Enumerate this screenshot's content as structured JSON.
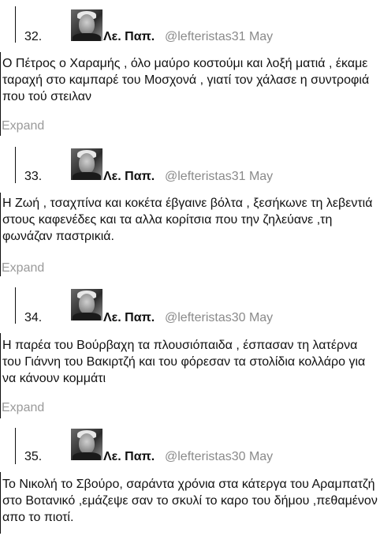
{
  "tweets": [
    {
      "number": "32.",
      "name": "Λε. Παπ.",
      "handle": "@lefteristas31 May",
      "text": "Ο Πέτρος ο Χαραμής , όλο μαύρο κοστούμι και λοξή ματιά , έκαμε ταραχή στο καμπαρέ του Μοσχονά , γιατί τον χάλασε η συντροφιά που τού στειλαν",
      "expand": "Expand"
    },
    {
      "number": "33.",
      "name": "Λε. Παπ.",
      "handle": "@lefteristas31 May",
      "text": "Η Ζωή , τσαχπίνα και κοκέτα έβγαινε βόλτα , ξεσήκωνε τη λεβεντιά στους καφενέδες και τα αλλα κορίτσια που την ζηλεύανε ,τη φωνάζαν παστρικιά.",
      "expand": "Expand"
    },
    {
      "number": "34.",
      "name": "Λε. Παπ.",
      "handle": "@lefteristas30 May",
      "text": "Η παρέα του Βούρβαχη τα πλουσιόπαιδα , έσπασαν τη λατέρνα του Γιάννη του Βακιρτζή και του φόρεσαν τα στολίδια κολλάρο για να κάνουν κομμάτι",
      "expand": "Expand"
    },
    {
      "number": "35.",
      "name": "Λε. Παπ.",
      "handle": "@lefteristas30 May",
      "text": "Το Νικολή το Σβούρο, σαράντα χρόνια στα κάτεργα του Αραμπατζή στο Βοτανικό ,εμάζεψε σαν το σκυλί το καρο του δήμου ,πεθαμένον απο το πιοτί."
    }
  ]
}
